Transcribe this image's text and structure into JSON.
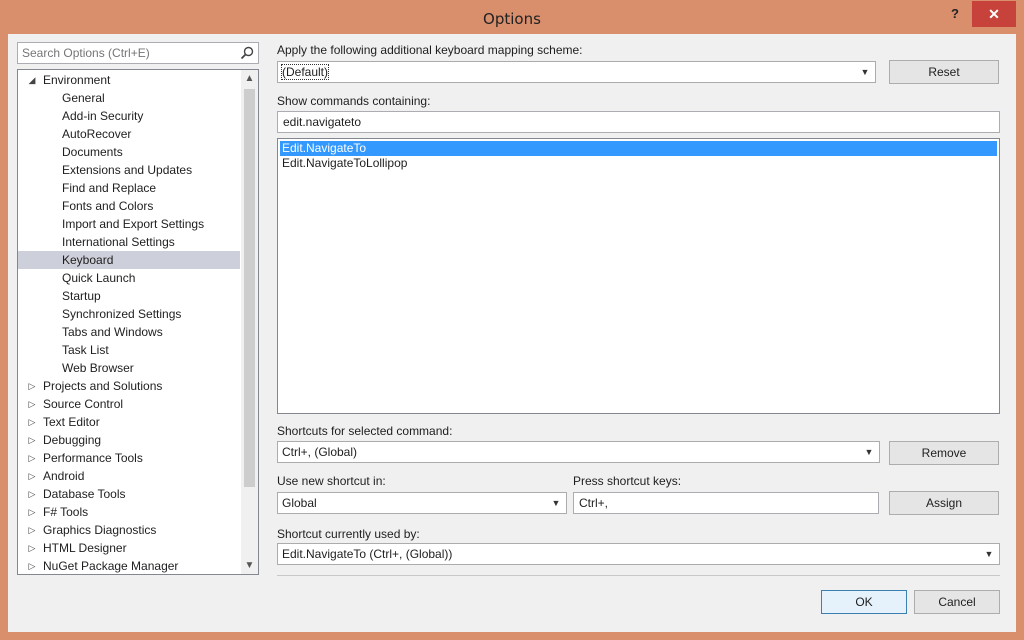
{
  "window": {
    "title": "Options",
    "help": "?",
    "close": "✕"
  },
  "search": {
    "placeholder": "Search Options (Ctrl+E)"
  },
  "tree": {
    "items": [
      {
        "label": "Environment",
        "level": 0,
        "expanded": true
      },
      {
        "label": "General",
        "level": 1
      },
      {
        "label": "Add-in Security",
        "level": 1
      },
      {
        "label": "AutoRecover",
        "level": 1
      },
      {
        "label": "Documents",
        "level": 1
      },
      {
        "label": "Extensions and Updates",
        "level": 1
      },
      {
        "label": "Find and Replace",
        "level": 1
      },
      {
        "label": "Fonts and Colors",
        "level": 1
      },
      {
        "label": "Import and Export Settings",
        "level": 1
      },
      {
        "label": "International Settings",
        "level": 1
      },
      {
        "label": "Keyboard",
        "level": 1,
        "selected": true
      },
      {
        "label": "Quick Launch",
        "level": 1
      },
      {
        "label": "Startup",
        "level": 1
      },
      {
        "label": "Synchronized Settings",
        "level": 1
      },
      {
        "label": "Tabs and Windows",
        "level": 1
      },
      {
        "label": "Task List",
        "level": 1
      },
      {
        "label": "Web Browser",
        "level": 1
      },
      {
        "label": "Projects and Solutions",
        "level": 0
      },
      {
        "label": "Source Control",
        "level": 0
      },
      {
        "label": "Text Editor",
        "level": 0
      },
      {
        "label": "Debugging",
        "level": 0
      },
      {
        "label": "Performance Tools",
        "level": 0
      },
      {
        "label": "Android",
        "level": 0
      },
      {
        "label": "Database Tools",
        "level": 0
      },
      {
        "label": "F# Tools",
        "level": 0
      },
      {
        "label": "Graphics Diagnostics",
        "level": 0
      },
      {
        "label": "HTML Designer",
        "level": 0
      },
      {
        "label": "NuGet Package Manager",
        "level": 0
      }
    ]
  },
  "mapping": {
    "label": "Apply the following additional keyboard mapping scheme:",
    "value": "(Default)",
    "reset": "Reset"
  },
  "commands": {
    "label": "Show commands containing:",
    "value": "edit.navigateto",
    "list": [
      {
        "text": "Edit.NavigateTo",
        "selected": true
      },
      {
        "text": "Edit.NavigateToLollipop",
        "selected": false
      }
    ]
  },
  "shortcuts": {
    "label": "Shortcuts for selected command:",
    "value": "Ctrl+, (Global)",
    "remove": "Remove"
  },
  "new_shortcut": {
    "label": "Use new shortcut in:",
    "value": "Global"
  },
  "press_keys": {
    "label": "Press shortcut keys:",
    "value": "Ctrl+,",
    "assign": "Assign"
  },
  "used_by": {
    "label": "Shortcut currently used by:",
    "value": "Edit.NavigateTo (Ctrl+, (Global))"
  },
  "footer": {
    "ok": "OK",
    "cancel": "Cancel"
  },
  "colors": {
    "selection": "#3399ff",
    "tree_selection": "#cdd0da",
    "frame": "#d98e6c",
    "close": "#c7423b"
  }
}
